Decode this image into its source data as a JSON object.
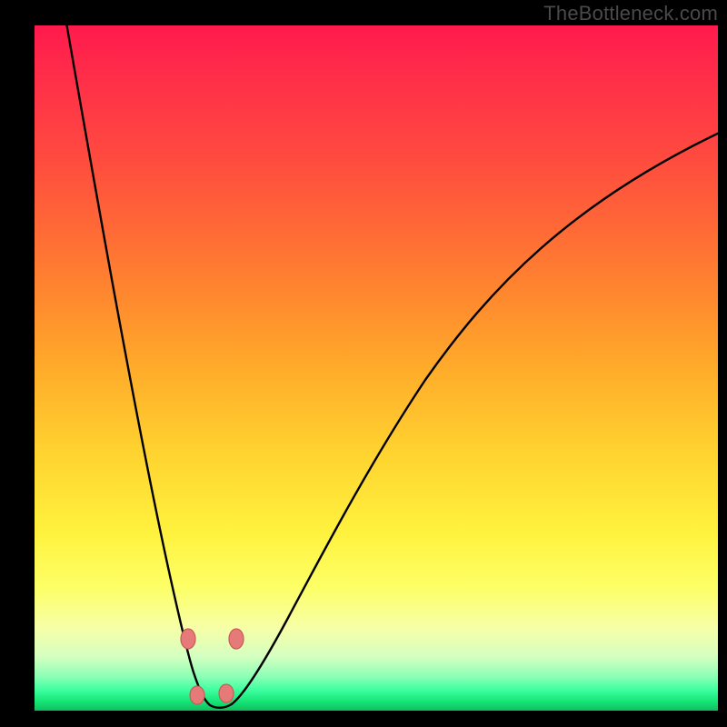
{
  "watermark": {
    "text": "TheBottleneck.com"
  },
  "colors": {
    "background": "#000000",
    "curve_stroke": "#000000",
    "marker_fill": "#e67a78",
    "marker_stroke": "#c95a56",
    "gradient_top": "#ff1a4d",
    "gradient_bottom": "#0fbf5e"
  },
  "chart_data": {
    "type": "line",
    "title": "",
    "xlabel": "",
    "ylabel": "",
    "xlim": [
      0,
      100
    ],
    "ylim": [
      0,
      100
    ],
    "grid": false,
    "legend": false,
    "note": "Axis values are estimated from pixel positions; the image shows no tick labels. y is a bottleneck-style metric (0 = ideal, at bottom green band; 100 = worst, at top red).",
    "x": [
      4,
      6,
      8,
      10,
      12,
      14,
      16,
      18,
      20,
      22,
      23,
      24,
      25,
      26,
      27,
      28,
      30,
      33,
      36,
      40,
      45,
      50,
      55,
      60,
      65,
      70,
      75,
      80,
      85,
      90,
      95,
      100
    ],
    "values": [
      100,
      91,
      82,
      73,
      64,
      55,
      46,
      37,
      26,
      13,
      7,
      3,
      1,
      1,
      2,
      4,
      9,
      17,
      25,
      34,
      43,
      51,
      58,
      64,
      70,
      75,
      79,
      83,
      86,
      89,
      91,
      93
    ],
    "minimum_region": {
      "x_start": 23,
      "x_end": 28,
      "y_approx": 1
    },
    "markers": [
      {
        "x": 22.3,
        "y": 10.5
      },
      {
        "x": 28.8,
        "y": 10.5
      },
      {
        "x": 23.4,
        "y": 2.2
      },
      {
        "x": 27.6,
        "y": 2.5
      }
    ],
    "markers_note": "Four salmon-colored bead markers near the trough of the curve."
  }
}
